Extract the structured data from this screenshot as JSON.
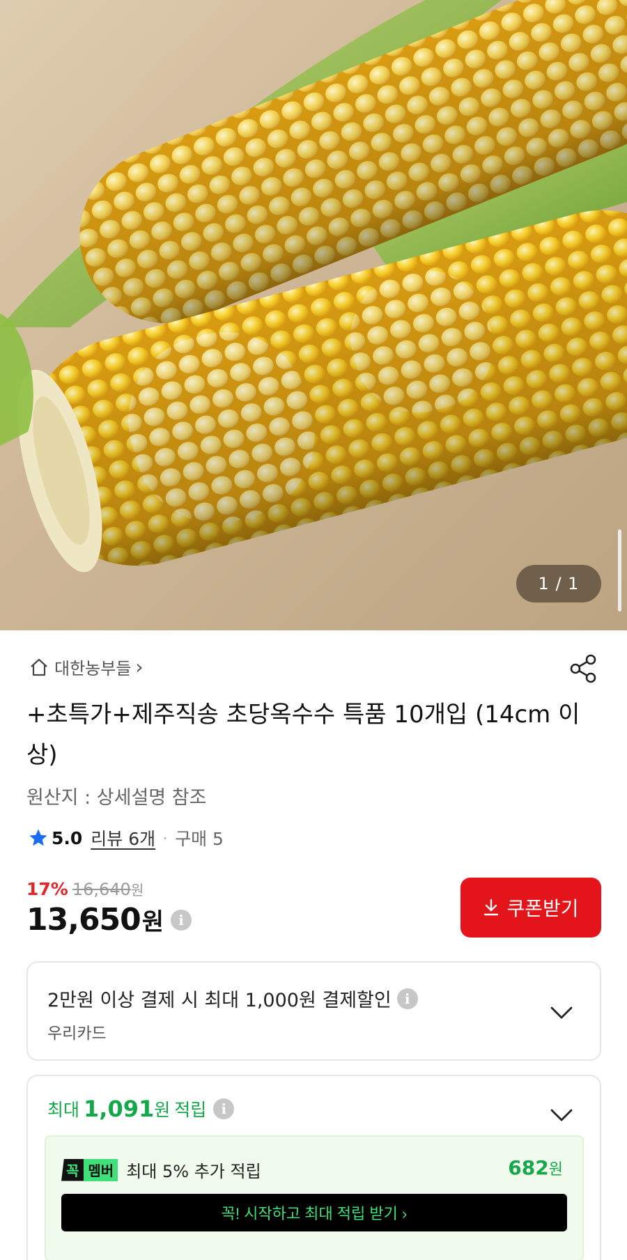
{
  "hero": {
    "counter": "1 / 1"
  },
  "seller": {
    "name": "대한농부들",
    "arrow": "›"
  },
  "product": {
    "title": "+초특가+제주직송 초당옥수수 특품 10개입 (14cm 이상)",
    "origin": "원산지 : 상세설명 참조"
  },
  "rating": {
    "score": "5.0",
    "reviews": "리뷰 6개",
    "separator": "·",
    "purchases": "구매 5"
  },
  "price": {
    "discount": "17%",
    "original": "16,640",
    "original_unit": "원",
    "current": "13,650",
    "unit": "원",
    "info_glyph": "i"
  },
  "coupon": {
    "label": "쿠폰받기",
    "color": "#e3151b"
  },
  "card_discount": {
    "text": "2만원 이상 결제 시 최대 1,000원 결제할인",
    "card": "우리카드"
  },
  "points": {
    "prefix": "최대",
    "amount": "1,091",
    "unit": "원",
    "suffix": "적립",
    "member": {
      "badge_left": "꼭",
      "badge_right": "멤버",
      "text": "최대 5% 추가 적립",
      "amount": "682",
      "unit": "원",
      "button": "꼭! 시작하고 최대 적립 받기  ›"
    },
    "accent": "#14a84a"
  },
  "icons": [
    "home-icon",
    "share-icon",
    "star-icon",
    "info-icon",
    "download-icon",
    "chevron-down-icon"
  ]
}
